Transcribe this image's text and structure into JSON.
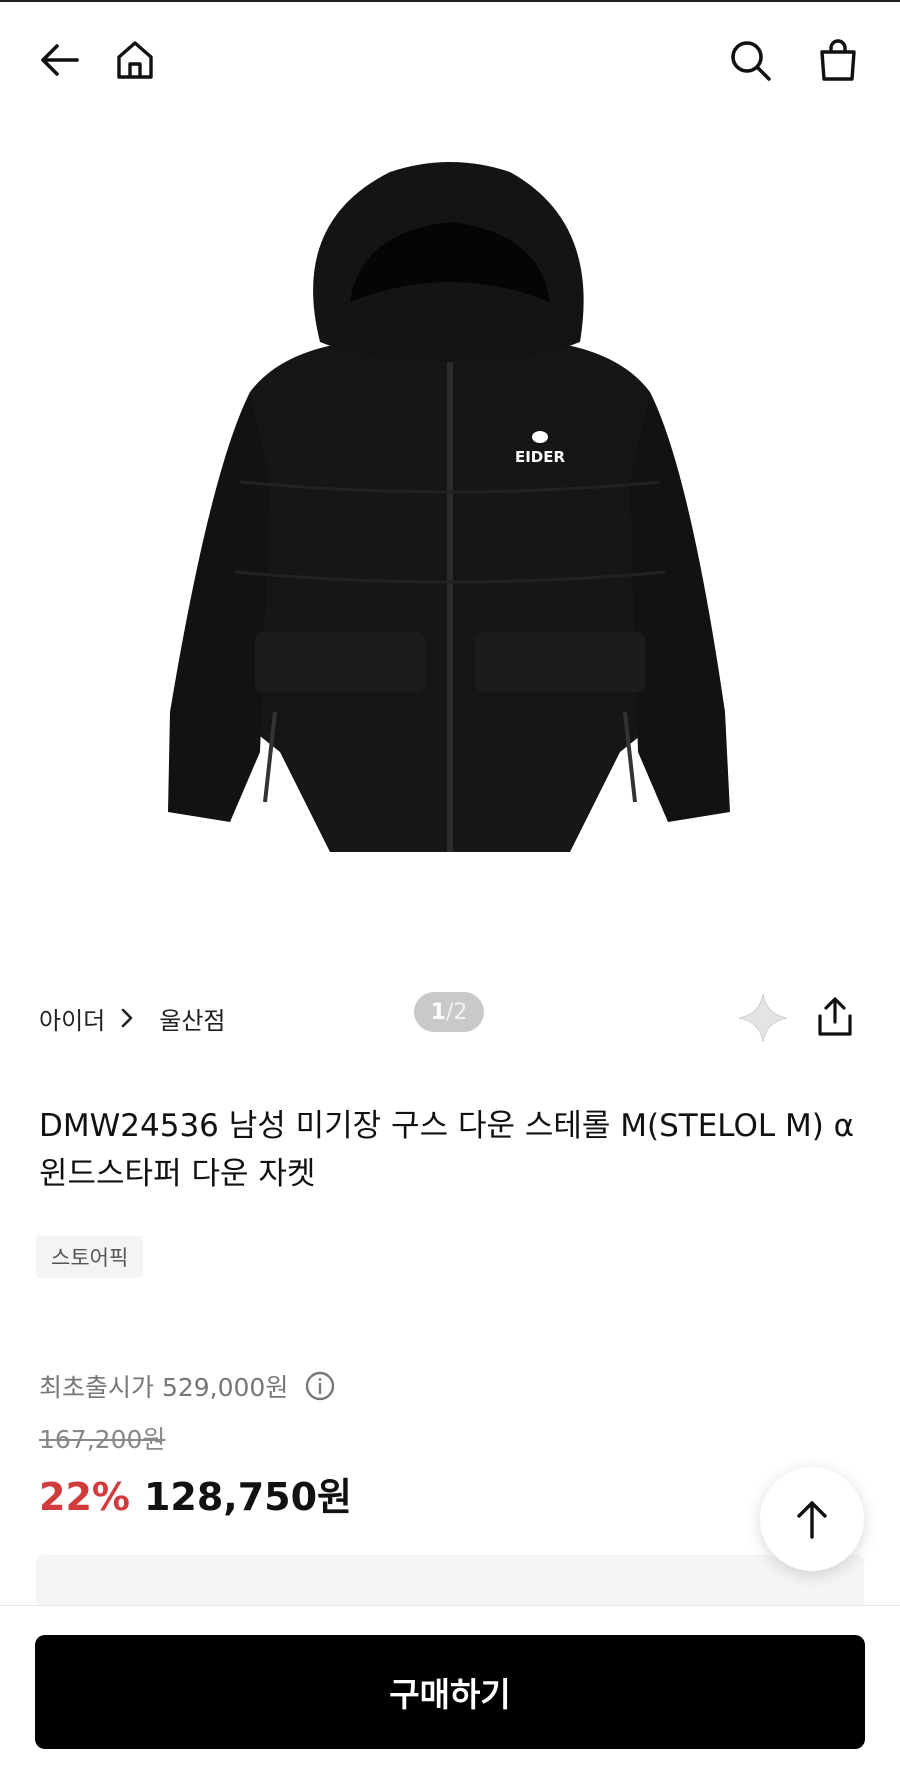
{
  "header": {
    "back_icon": "back-arrow-icon",
    "home_icon": "home-icon",
    "search_icon": "search-icon",
    "cart_icon": "shopping-bag-icon"
  },
  "gallery": {
    "current": "1",
    "separator": "/",
    "total": "2",
    "logo_text": "EIDER"
  },
  "breadcrumb": {
    "brand": "아이더",
    "store": "울산점"
  },
  "product": {
    "title": "DMW24536 남성 미기장 구스 다운 스테롤 M(STELOL M) α 윈드스타퍼 다운 자켓",
    "badge": "스토어픽"
  },
  "price": {
    "original_label": "최초출시가 529,000원",
    "list_price": "167,200원",
    "discount": "22%",
    "final_price": "128,750원"
  },
  "actions": {
    "buy_label": "구매하기"
  }
}
